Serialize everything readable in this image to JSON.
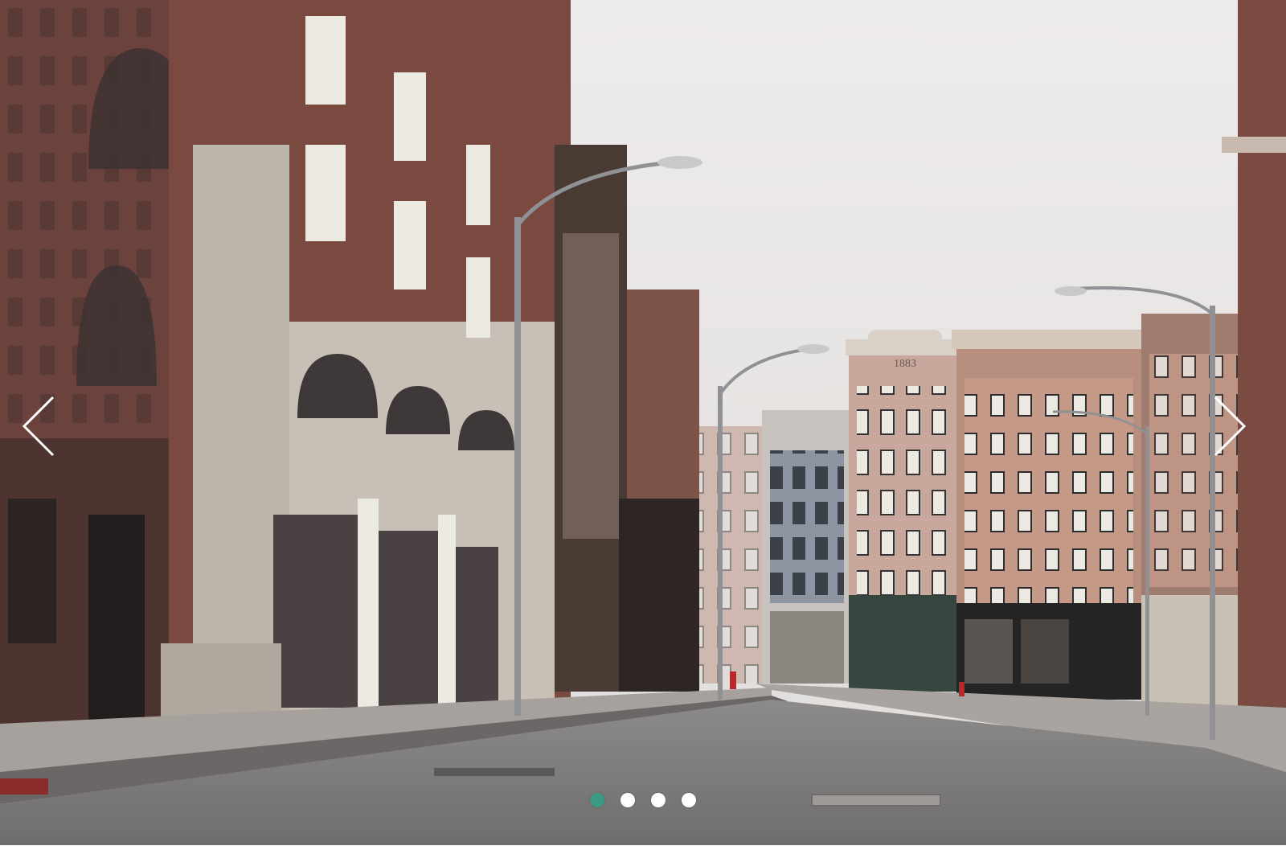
{
  "carousel": {
    "prev_icon": "chevron-left-icon",
    "next_icon": "chevron-right-icon",
    "slide_count": 4,
    "active_index": 0,
    "colors": {
      "active_dot": "#3a9a82",
      "inactive_dot": "#ffffff",
      "arrow": "#ffffff"
    }
  },
  "slide": {
    "building_sign": "1883"
  }
}
